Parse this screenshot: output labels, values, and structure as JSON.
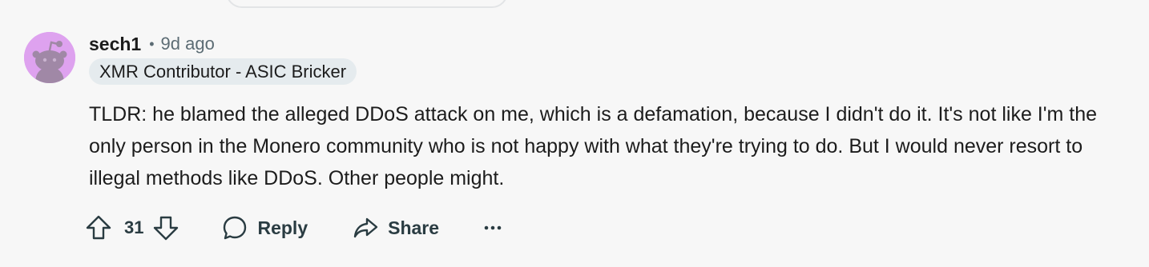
{
  "comment": {
    "username": "sech1",
    "separator": "•",
    "timestamp": "9d ago",
    "flair": "XMR Contributor - ASIC Bricker",
    "body": "TLDR: he blamed the alleged DDoS attack on me, which is a defamation, because I didn't do it. It's not like I'm the only person in the Monero community who is not happy with what they're trying to do. But I would never resort to illegal methods like DDoS. Other people might.",
    "avatar_color": "#dea2ef",
    "flair_color": "#e5ebee"
  },
  "actions": {
    "upvote_icon": "arrow-up-outline-icon",
    "vote_count": "31",
    "downvote_icon": "arrow-down-outline-icon",
    "reply_icon": "speech-bubble-icon",
    "reply_label": "Reply",
    "share_icon": "share-arrow-icon",
    "share_label": "Share",
    "more_icon": "ellipsis-icon"
  }
}
